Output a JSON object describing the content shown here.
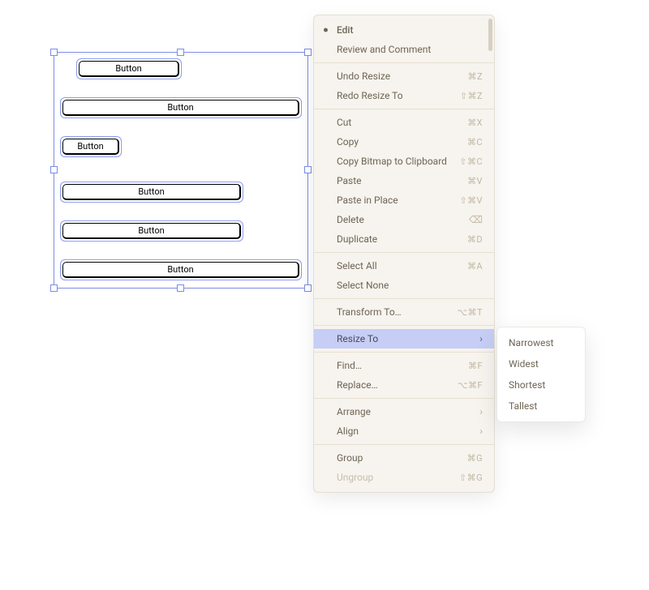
{
  "canvas": {
    "buttons": [
      {
        "label": "Button"
      },
      {
        "label": "Button"
      },
      {
        "label": "Button"
      },
      {
        "label": "Button"
      },
      {
        "label": "Button"
      },
      {
        "label": "Button"
      }
    ]
  },
  "menu": {
    "title": "Edit",
    "sections": [
      [
        {
          "label": "Review and Comment",
          "shortcut": ""
        }
      ],
      [
        {
          "label": "Undo Resize",
          "shortcut": "⌘Z"
        },
        {
          "label": "Redo Resize To",
          "shortcut": "⇧⌘Z"
        }
      ],
      [
        {
          "label": "Cut",
          "shortcut": "⌘X"
        },
        {
          "label": "Copy",
          "shortcut": "⌘C"
        },
        {
          "label": "Copy Bitmap to Clipboard",
          "shortcut": "⇧⌘C"
        },
        {
          "label": "Paste",
          "shortcut": "⌘V"
        },
        {
          "label": "Paste in Place",
          "shortcut": "⇧⌘V"
        },
        {
          "label": "Delete",
          "shortcut": "eye"
        },
        {
          "label": "Duplicate",
          "shortcut": "⌘D"
        }
      ],
      [
        {
          "label": "Select All",
          "shortcut": "⌘A"
        },
        {
          "label": "Select None",
          "shortcut": ""
        }
      ],
      [
        {
          "label": "Transform To…",
          "shortcut": "⌥⌘T"
        }
      ],
      [
        {
          "label": "Resize To",
          "shortcut": "chevron",
          "highlight": true
        }
      ],
      [
        {
          "label": "Find…",
          "shortcut": "⌘F"
        },
        {
          "label": "Replace…",
          "shortcut": "⌥⌘F"
        }
      ],
      [
        {
          "label": "Arrange",
          "shortcut": "chevron"
        },
        {
          "label": "Align",
          "shortcut": "chevron"
        }
      ],
      [
        {
          "label": "Group",
          "shortcut": "⌘G"
        },
        {
          "label": "Ungroup",
          "shortcut": "⇧⌘G",
          "disabled": true
        }
      ]
    ]
  },
  "submenu": {
    "items": [
      {
        "label": "Narrowest"
      },
      {
        "label": "Widest"
      },
      {
        "label": "Shortest"
      },
      {
        "label": "Tallest"
      }
    ]
  }
}
